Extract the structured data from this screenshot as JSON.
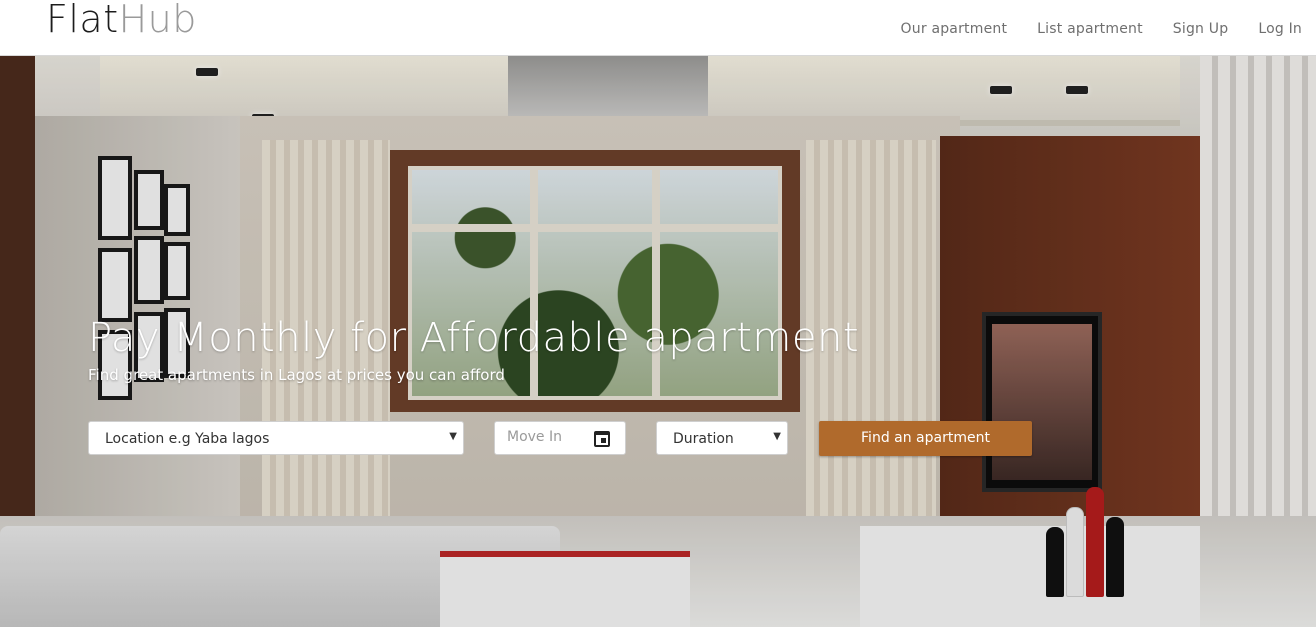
{
  "brand": {
    "part1": "Flat",
    "part2": "Hub"
  },
  "nav": {
    "items": [
      {
        "label": "Our apartment"
      },
      {
        "label": "List apartment"
      },
      {
        "label": "Sign Up"
      },
      {
        "label": "Log In"
      }
    ]
  },
  "hero": {
    "headline": "Pay Monthly for Affordable apartment",
    "subline": "Find great apartments in Lagos at prices you can afford"
  },
  "search": {
    "location_value": "Location e.g Yaba lagos",
    "move_in_placeholder": "Move In",
    "duration_value": "Duration",
    "submit_label": "Find an apartment"
  },
  "colors": {
    "accent": "#b06a2c",
    "brand_dark": "#1c1c1c",
    "brand_light": "#9a9a9a"
  }
}
